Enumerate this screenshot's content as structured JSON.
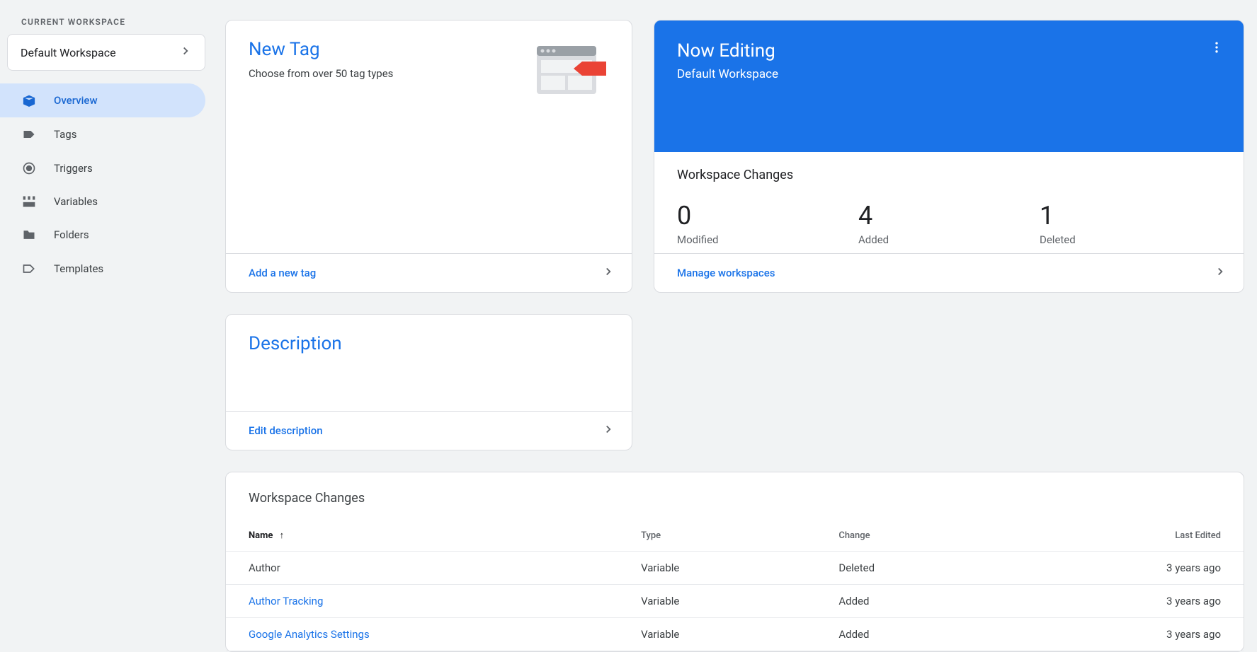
{
  "sidebar": {
    "section_label": "CURRENT WORKSPACE",
    "workspace_name": "Default Workspace",
    "nav": [
      {
        "label": "Overview",
        "icon": "box",
        "active": true
      },
      {
        "label": "Tags",
        "icon": "tag",
        "active": false
      },
      {
        "label": "Triggers",
        "icon": "trigger",
        "active": false
      },
      {
        "label": "Variables",
        "icon": "variables",
        "active": false
      },
      {
        "label": "Folders",
        "icon": "folder",
        "active": false
      },
      {
        "label": "Templates",
        "icon": "template",
        "active": false
      }
    ]
  },
  "new_tag_card": {
    "title": "New Tag",
    "subtitle": "Choose from over 50 tag types",
    "action": "Add a new tag"
  },
  "description_card": {
    "title": "Description",
    "action": "Edit description"
  },
  "editing_card": {
    "title": "Now Editing",
    "workspace": "Default Workspace",
    "stats_title": "Workspace Changes",
    "stats": [
      {
        "value": "0",
        "label": "Modified"
      },
      {
        "value": "4",
        "label": "Added"
      },
      {
        "value": "1",
        "label": "Deleted"
      }
    ],
    "action": "Manage workspaces"
  },
  "changes_table": {
    "title": "Workspace Changes",
    "columns": {
      "name": "Name",
      "type": "Type",
      "change": "Change",
      "last_edited": "Last Edited"
    },
    "rows": [
      {
        "name": "Author",
        "link": false,
        "type": "Variable",
        "change": "Deleted",
        "last_edited": "3 years ago"
      },
      {
        "name": "Author Tracking",
        "link": true,
        "type": "Variable",
        "change": "Added",
        "last_edited": "3 years ago"
      },
      {
        "name": "Google Analytics Settings",
        "link": true,
        "type": "Variable",
        "change": "Added",
        "last_edited": "3 years ago"
      }
    ]
  }
}
